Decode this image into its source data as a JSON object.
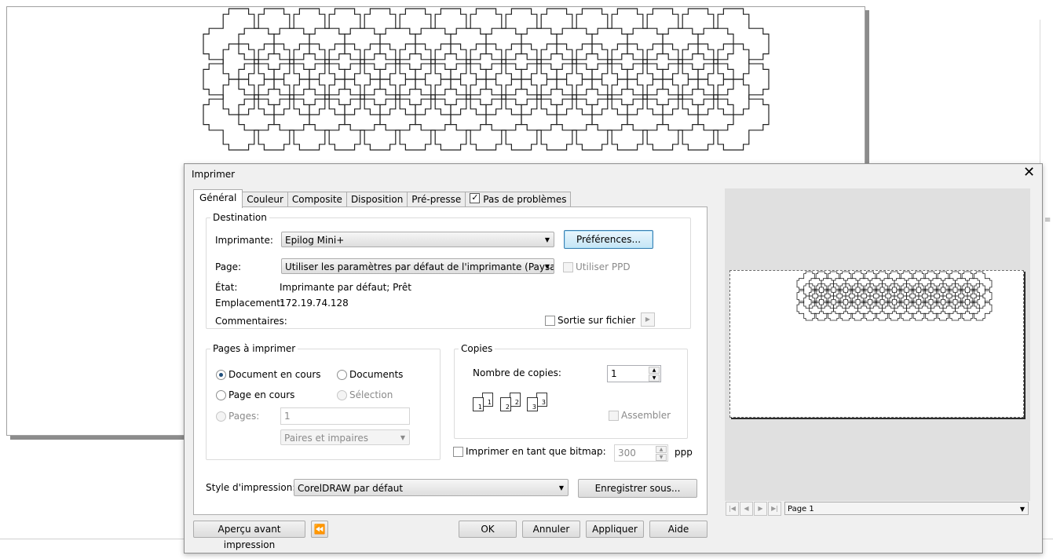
{
  "dialog": {
    "title": "Imprimer",
    "close_symbol": "✕"
  },
  "tabs": [
    {
      "label": "Général",
      "active": true
    },
    {
      "label": "Couleur"
    },
    {
      "label": "Composite"
    },
    {
      "label": "Disposition"
    },
    {
      "label": "Pré-presse"
    },
    {
      "label": "Pas de problèmes",
      "icon": "checklist-icon"
    }
  ],
  "destination": {
    "legend": "Destination",
    "printer_label": "Imprimante:",
    "printer_value": "Epilog Mini+",
    "preferences_button": "Préférences...",
    "page_label": "Page:",
    "page_value": "Utiliser les paramètres par défaut de l'imprimante (Paysage)",
    "use_ppd_label": "Utiliser PPD",
    "state_label": "État:",
    "state_value": "Imprimante par défaut; Prêt",
    "location_label": "Emplacement:",
    "location_value": "172.19.74.128",
    "comments_label": "Commentaires:",
    "print_to_file_label": "Sortie sur fichier",
    "print_to_file_arrow": "▶"
  },
  "pages": {
    "legend": "Pages à imprimer",
    "current_document": "Document en cours",
    "documents": "Documents",
    "current_page": "Page en cours",
    "selection": "Sélection",
    "pages_label": "Pages:",
    "pages_value": "1",
    "parity_value": "Paires et impaires",
    "selected": "current_document"
  },
  "copies": {
    "legend": "Copies",
    "count_label": "Nombre de copies:",
    "count_value": "1",
    "collate_label": "Assembler",
    "stack_numbers": [
      "1",
      "1",
      "2",
      "2",
      "3",
      "3"
    ]
  },
  "bitmap": {
    "label": "Imprimer en tant que bitmap:",
    "dpi_value": "300",
    "dpi_unit": "ppp"
  },
  "style": {
    "label": "Style d'impression:",
    "value": "CorelDRAW par défaut",
    "save_as_button": "Enregistrer sous..."
  },
  "footer": {
    "preview_button": "Aperçu avant impression",
    "collapse_icon": "collapse-preview-icon",
    "ok_button": "OK",
    "cancel_button": "Annuler",
    "apply_button": "Appliquer",
    "help_button": "Aide"
  },
  "preview": {
    "page_select_value": "Page 1"
  },
  "colors": {
    "dialog_bg": "#f0f0f0",
    "preview_bg": "#e0e0e0",
    "default_button_border": "#3c7fb1"
  }
}
